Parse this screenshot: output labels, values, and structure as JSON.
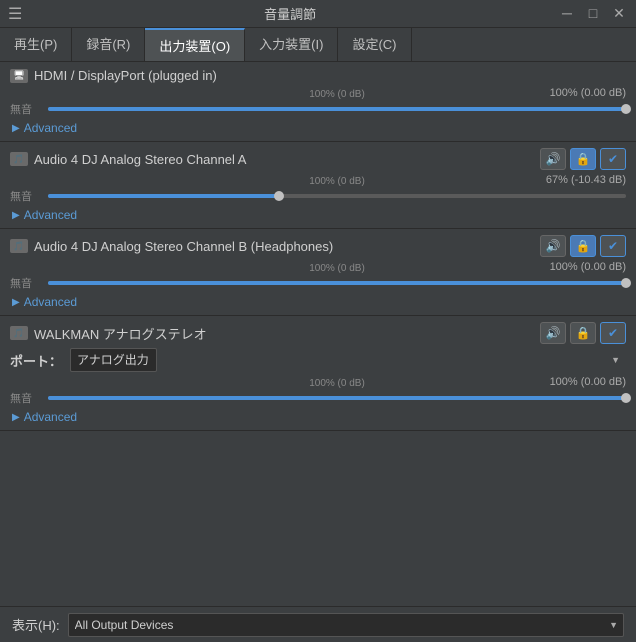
{
  "titlebar": {
    "menu_icon": "☰",
    "title": "音量調節",
    "minimize": "─",
    "restore": "□",
    "close": "✕"
  },
  "tabs": [
    {
      "label": "再生(P)",
      "active": false
    },
    {
      "label": "録音(R)",
      "active": false
    },
    {
      "label": "出力装置(O)",
      "active": true
    },
    {
      "label": "入力装置(I)",
      "active": false
    },
    {
      "label": "設定(C)",
      "active": false
    }
  ],
  "devices": [
    {
      "id": "device1",
      "name": "HDMI / DisplayPort (plugged in)",
      "volume_percent": "100% (0.00 dB)",
      "slider_fill_pct": 100,
      "slider_thumb_pct": 100,
      "label_mute": "無音",
      "label_center": "100% (0 dB)",
      "show_lock": false,
      "show_check": false,
      "advanced_label": "Advanced",
      "has_port": false
    },
    {
      "id": "device2",
      "name": "Audio 4 DJ Analog Stereo Channel A",
      "volume_percent": "67% (-10.43 dB)",
      "slider_fill_pct": 40,
      "slider_thumb_pct": 40,
      "label_mute": "無音",
      "label_center": "100% (0 dB)",
      "show_lock": true,
      "lock_active": true,
      "show_check": true,
      "check_active": true,
      "advanced_label": "Advanced",
      "has_port": false
    },
    {
      "id": "device3",
      "name": "Audio 4 DJ Analog Stereo Channel B (Headphones)",
      "volume_percent": "100% (0.00 dB)",
      "slider_fill_pct": 100,
      "slider_thumb_pct": 100,
      "label_mute": "無音",
      "label_center": "100% (0 dB)",
      "show_lock": true,
      "lock_active": true,
      "show_check": true,
      "check_active": true,
      "advanced_label": "Advanced",
      "has_port": false
    },
    {
      "id": "device4",
      "name": "WALKMAN アナログステレオ",
      "volume_percent": "100% (0.00 dB)",
      "slider_fill_pct": 100,
      "slider_thumb_pct": 100,
      "label_mute": "無音",
      "label_center": "100% (0 dB)",
      "show_lock": true,
      "lock_active": false,
      "show_check": true,
      "check_active": true,
      "advanced_label": "Advanced",
      "has_port": true,
      "port_label": "ポート：",
      "port_value": "アナログ出力",
      "port_options": [
        "アナログ出力"
      ]
    }
  ],
  "bottom": {
    "show_label": "表示(H):",
    "show_value": "All Output Devices",
    "show_options": [
      "All Output Devices"
    ]
  }
}
